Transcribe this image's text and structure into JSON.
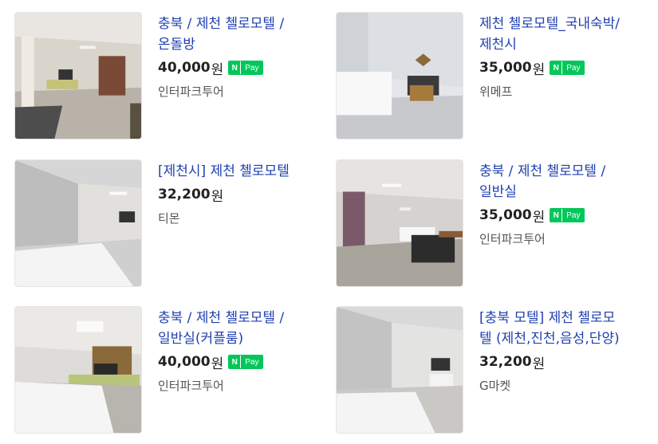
{
  "listings": [
    {
      "title_line1": "충북 / 제천 첼로모텔 /",
      "title_line2": "온돌방",
      "price": "40,000",
      "currency": "원",
      "npay": true,
      "seller": "인터파크투어"
    },
    {
      "title_line1": "제천 첼로모텔_국내숙박/",
      "title_line2": "제천시",
      "price": "35,000",
      "currency": "원",
      "npay": true,
      "seller": "위메프"
    },
    {
      "title_line1": "[제천시] 제천 첼로모텔",
      "title_line2": "",
      "price": "32,200",
      "currency": "원",
      "npay": false,
      "seller": "티몬"
    },
    {
      "title_line1": "충북 / 제천 첼로모텔 /",
      "title_line2": "일반실",
      "price": "35,000",
      "currency": "원",
      "npay": true,
      "seller": "인터파크투어"
    },
    {
      "title_line1": "충북 / 제천 첼로모텔 /",
      "title_line2": "일반실(커플룸)",
      "price": "40,000",
      "currency": "원",
      "npay": true,
      "seller": "인터파크투어"
    },
    {
      "title_line1": "[충북 모텔] 제천 첼로모",
      "title_line2": "텔 (제천,진천,음성,단양)",
      "price": "32,200",
      "currency": "원",
      "npay": false,
      "seller": "G마켓"
    }
  ],
  "npay_badge": {
    "n": "N",
    "pay": "Pay"
  },
  "colors": {
    "title": "#1f3fb0",
    "npay_green": "#03c75a"
  }
}
